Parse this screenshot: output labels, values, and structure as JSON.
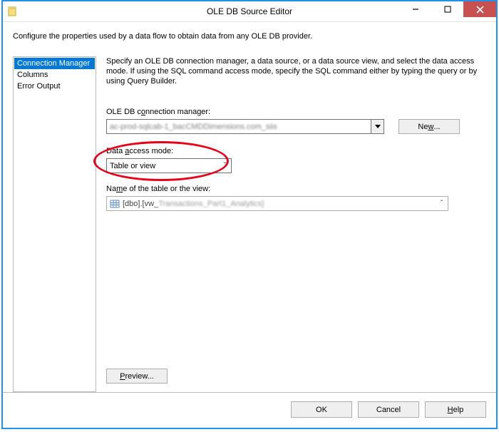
{
  "window": {
    "title": "OLE DB Source Editor"
  },
  "intro": "Configure the properties used by a data flow to obtain data from any OLE DB provider.",
  "sidebar": {
    "items": [
      {
        "label": "Connection Manager"
      },
      {
        "label": "Columns"
      },
      {
        "label": "Error Output"
      }
    ]
  },
  "content": {
    "description": "Specify an OLE DB connection manager, a data source, or a data source view, and select the data access mode. If using the SQL command access mode, specify the SQL command either by typing the query or by using Query Builder.",
    "conn_label_pre": "OLE DB c",
    "conn_label_u": "o",
    "conn_label_post": "nnection manager:",
    "conn_value": "ac-prod-sqlcab-1_bacCMDDimensions.com_siis",
    "new_button_pre": "Ne",
    "new_button_u": "w",
    "new_button_post": "...",
    "access_label_pre": "Data ",
    "access_label_u": "a",
    "access_label_post": "ccess mode:",
    "access_value": "Table or view",
    "table_label_pre": "Na",
    "table_label_u": "m",
    "table_label_post": "e of the table or the view:",
    "table_value_clear": "[dbo].[vw_",
    "table_value_obf": "Transactions_Part1_Analytics]",
    "preview_label_u": "P",
    "preview_label_post": "review..."
  },
  "footer": {
    "ok": "OK",
    "cancel": "Cancel",
    "help_u": "H",
    "help_post": "elp"
  }
}
